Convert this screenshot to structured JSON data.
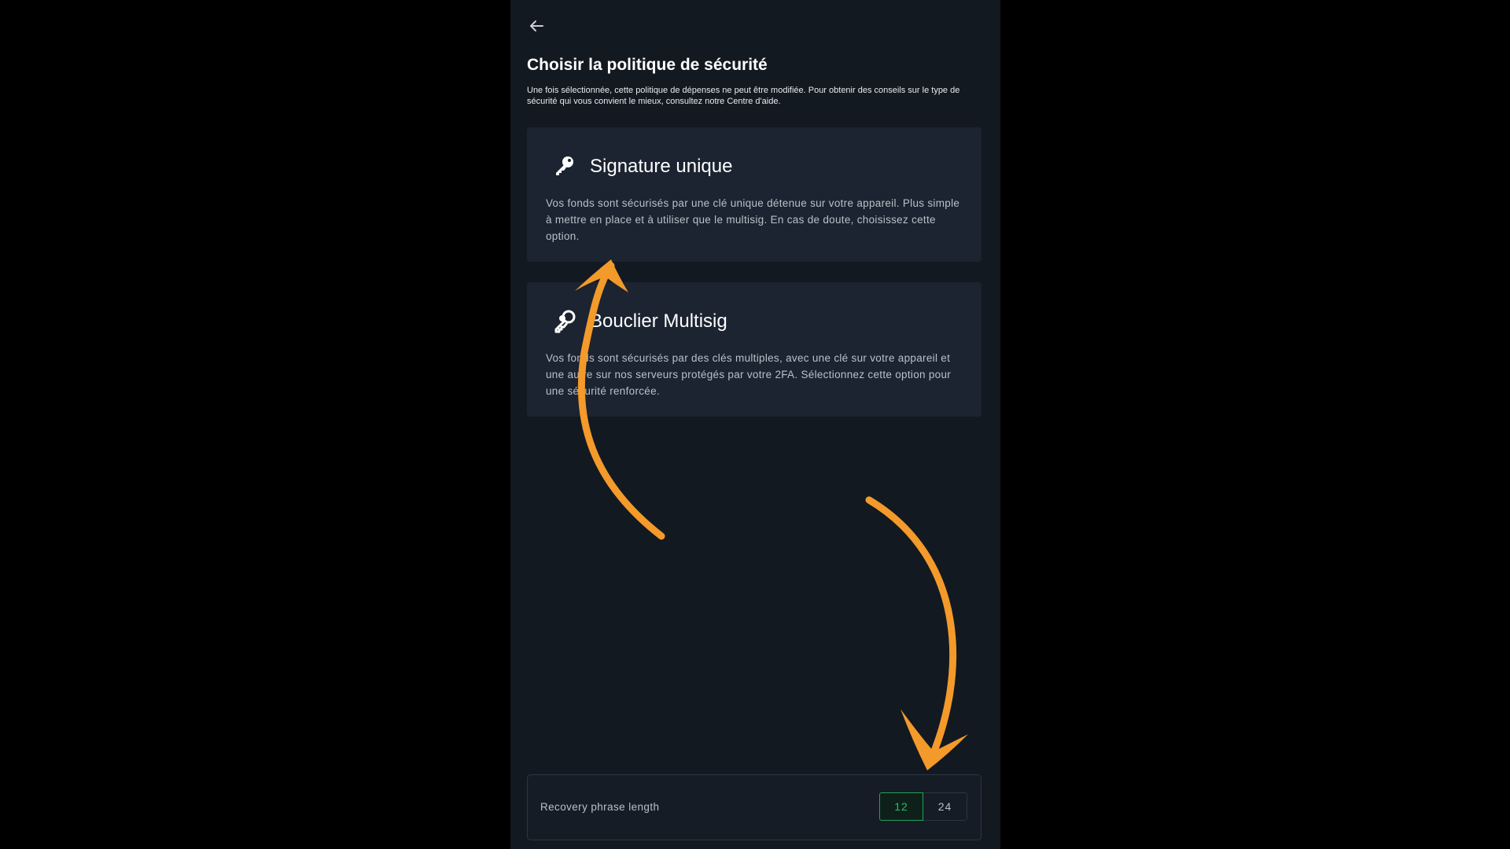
{
  "page": {
    "title": "Choisir la politique de sécurité",
    "subtitle": "Une fois sélectionnée, cette politique de dépenses ne peut être modifiée. Pour obtenir des conseils sur le type de sécurité qui vous convient le mieux, consultez notre Centre d'aide."
  },
  "options": [
    {
      "title": "Signature unique",
      "description": "Vos fonds sont sécurisés par une clé unique détenue sur votre appareil. Plus simple à mettre en place et à utiliser que le multisig. En cas de doute, choisissez cette option.",
      "icon": "key-icon"
    },
    {
      "title": "Bouclier Multisig",
      "description": "Vos fonds sont sécurisés par des clés multiples, avec une clé sur votre appareil et une autre sur nos serveurs protégés par votre 2FA. Sélectionnez cette option pour une sécurité renforcée.",
      "icon": "multi-key-icon"
    }
  ],
  "recovery": {
    "label": "Recovery phrase length",
    "options": [
      "12",
      "24"
    ],
    "selected": "12"
  },
  "colors": {
    "background": "#131921",
    "card": "#1b2430",
    "accent_green": "#22c06a",
    "annotation_orange": "#f39a2b"
  }
}
